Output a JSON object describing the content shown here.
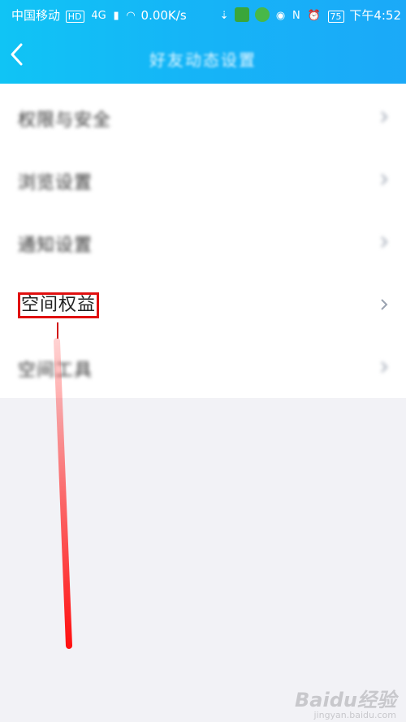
{
  "status_bar": {
    "carrier": "中国移动",
    "network_badge": "HD",
    "signal_type": "4G",
    "speed": "0.00K/s",
    "battery": "75",
    "time": "下午4:52"
  },
  "nav": {
    "title": "好友动态设置"
  },
  "menu": {
    "items": [
      {
        "label": "权限与安全"
      },
      {
        "label": "浏览设置"
      },
      {
        "label": "通知设置"
      },
      {
        "label": "空间权益"
      },
      {
        "label": "空间工具"
      }
    ]
  },
  "watermark": {
    "brand": "Baidu经验",
    "url": "jingyan.baidu.com"
  },
  "colors": {
    "header_accent": "#15b5f7",
    "highlight": "#e01010"
  }
}
